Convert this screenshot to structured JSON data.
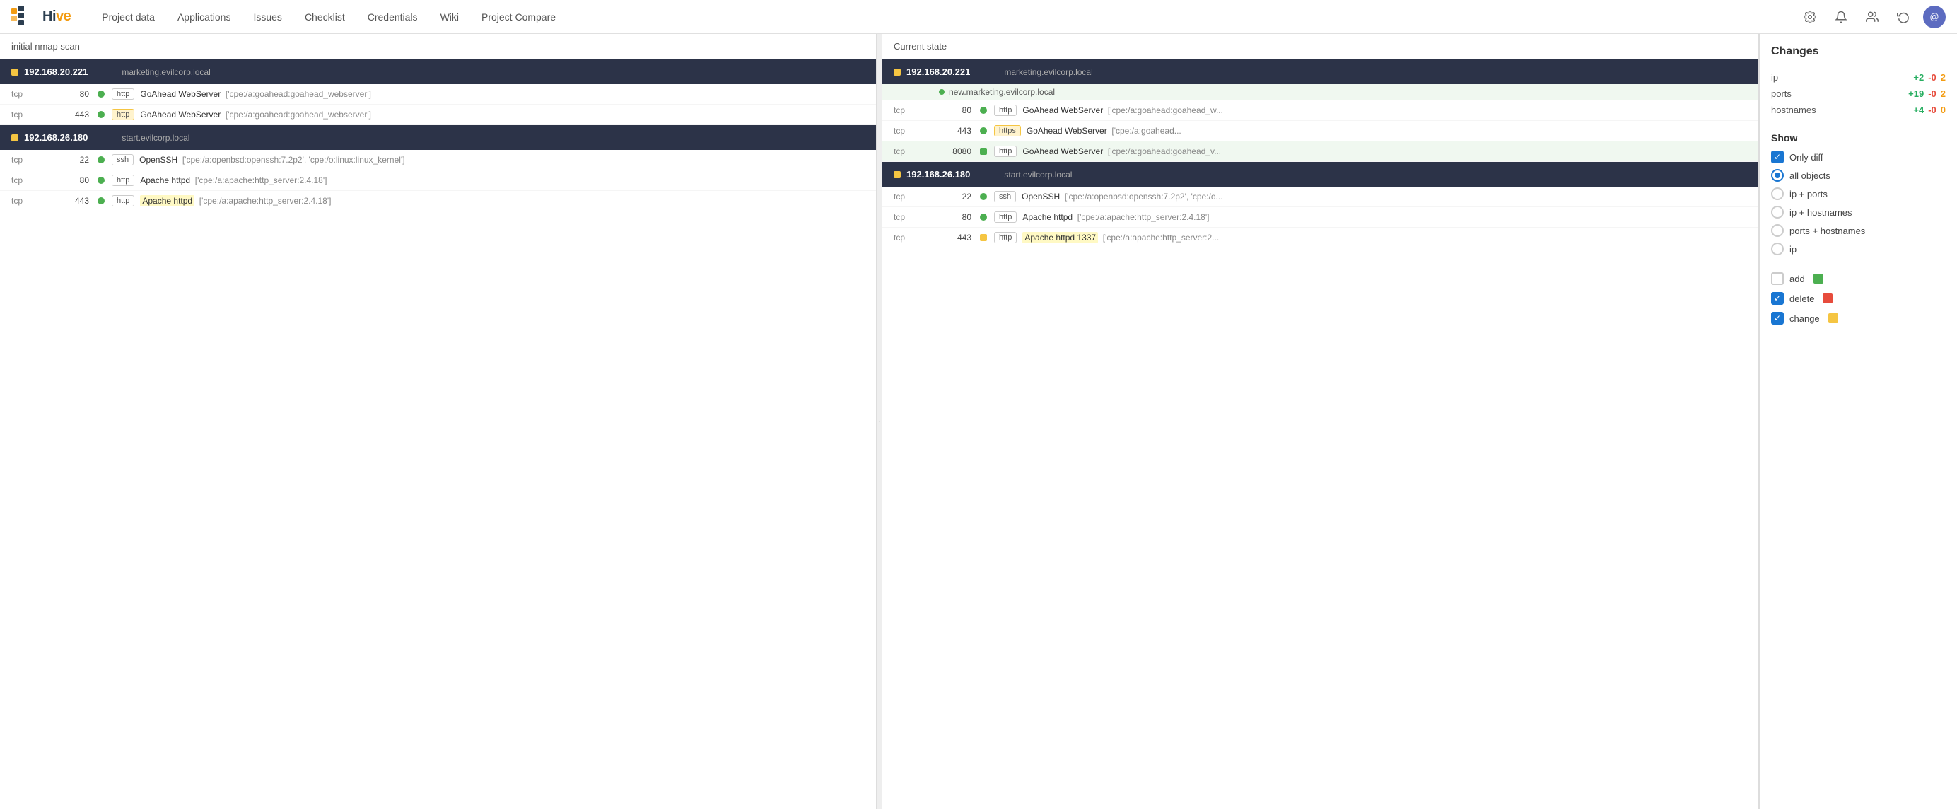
{
  "navbar": {
    "logo": "HIVE",
    "links": [
      {
        "label": "Project data",
        "id": "project-data"
      },
      {
        "label": "Applications",
        "id": "applications"
      },
      {
        "label": "Issues",
        "id": "issues"
      },
      {
        "label": "Checklist",
        "id": "checklist"
      },
      {
        "label": "Credentials",
        "id": "credentials"
      },
      {
        "label": "Wiki",
        "id": "wiki"
      },
      {
        "label": "Project Compare",
        "id": "project-compare"
      }
    ]
  },
  "left_panel": {
    "header": "initial nmap scan",
    "ip_blocks": [
      {
        "ip": "192.168.20.221",
        "hostname": "marketing.evilcorp.local",
        "ports": [
          {
            "protocol": "tcp",
            "port": "80",
            "tag": "http",
            "tag_highlighted": false,
            "service": "GoAhead WebServer",
            "cpe": "['cpe:/a:goahead:goahead_webserver']"
          },
          {
            "protocol": "tcp",
            "port": "443",
            "tag": "http",
            "tag_highlighted": true,
            "service": "GoAhead WebServer",
            "cpe": "['cpe:/a:goahead:goahead_webserver']"
          }
        ]
      },
      {
        "ip": "192.168.26.180",
        "hostname": "start.evilcorp.local",
        "ports": [
          {
            "protocol": "tcp",
            "port": "22",
            "tag": "ssh",
            "tag_highlighted": false,
            "service": "OpenSSH",
            "cpe": "['cpe:/a:openbsd:openssh:7.2p2', 'cpe:/o:linux:linux_kernel']"
          },
          {
            "protocol": "tcp",
            "port": "80",
            "tag": "http",
            "tag_highlighted": false,
            "service": "Apache httpd",
            "cpe": "['cpe:/a:apache:http_server:2.4.18']"
          },
          {
            "protocol": "tcp",
            "port": "443",
            "tag": "http",
            "tag_highlighted": false,
            "service": "Apache httpd",
            "cpe": "['cpe:/a:apache:http_server:2.4.18']",
            "service_highlighted": true
          }
        ]
      }
    ]
  },
  "right_panel": {
    "header": "Current state",
    "ip_blocks": [
      {
        "ip": "192.168.20.221",
        "dot_color": "yellow",
        "hostnames": [
          {
            "name": "marketing.evilcorp.local",
            "dot": "none"
          },
          {
            "name": "new.marketing.evilcorp.local",
            "dot": "green"
          }
        ],
        "ports": [
          {
            "protocol": "tcp",
            "port": "80",
            "tag": "http",
            "tag_highlighted": false,
            "service": "GoAhead WebServer",
            "cpe": "['cpe:/a:goahead:goahead_w..."
          },
          {
            "protocol": "tcp",
            "port": "443",
            "tag": "https",
            "tag_highlighted": true,
            "service": "GoAhead WebServer",
            "cpe": "['cpe:/a:goahead..."
          },
          {
            "protocol": "tcp",
            "port": "8080",
            "tag": "http",
            "tag_highlighted": false,
            "service": "GoAhead WebServer",
            "cpe": "['cpe:/a:goahead:goahead_v...",
            "dot_green": true
          }
        ]
      },
      {
        "ip": "192.168.26.180",
        "dot_color": "yellow",
        "hostnames": [
          {
            "name": "start.evilcorp.local",
            "dot": "none"
          }
        ],
        "ports": [
          {
            "protocol": "tcp",
            "port": "22",
            "tag": "ssh",
            "tag_highlighted": false,
            "service": "OpenSSH",
            "cpe": "['cpe:/a:openbsd:openssh:7.2p2', 'cpe:/o..."
          },
          {
            "protocol": "tcp",
            "port": "80",
            "tag": "http",
            "tag_highlighted": false,
            "service": "Apache httpd",
            "cpe": "['cpe:/a:apache:http_server:2.4.18']"
          },
          {
            "protocol": "tcp",
            "port": "443",
            "tag": "http",
            "tag_highlighted": false,
            "service": "Apache httpd 1337",
            "cpe": "['cpe:/a:apache:http_server:2...",
            "dot_yellow": true,
            "service_highlighted": true
          }
        ]
      }
    ]
  },
  "changes": {
    "title": "Changes",
    "rows": [
      {
        "label": "ip",
        "add": "+2",
        "del": "-0",
        "count": "2"
      },
      {
        "label": "ports",
        "add": "+19",
        "del": "-0",
        "count": "2"
      },
      {
        "label": "hostnames",
        "add": "+4",
        "del": "-0",
        "count": "0"
      }
    ],
    "show_label": "Show",
    "radio_options": [
      {
        "label": "Only diff",
        "selected": false,
        "id": "only-diff"
      },
      {
        "label": "all objects",
        "selected": true,
        "id": "all-objects"
      },
      {
        "label": "ip + ports",
        "selected": false,
        "id": "ip-ports"
      },
      {
        "label": "ip + hostnames",
        "selected": false,
        "id": "ip-hostnames"
      },
      {
        "label": "ports + hostnames",
        "selected": false,
        "id": "ports-hostnames"
      },
      {
        "label": "ip",
        "selected": false,
        "id": "ip-only"
      }
    ],
    "checkboxes": [
      {
        "label": "add",
        "checked": false,
        "color": "green",
        "id": "cb-add"
      },
      {
        "label": "delete",
        "checked": true,
        "color": "red",
        "id": "cb-delete"
      },
      {
        "label": "change",
        "checked": true,
        "color": "yellow",
        "id": "cb-change"
      }
    ]
  }
}
